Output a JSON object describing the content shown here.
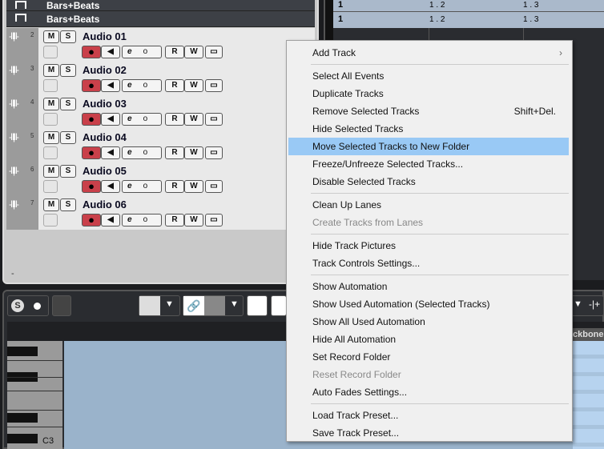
{
  "ruler": {
    "label": "Bars+Beats",
    "marks": [
      "1",
      "1 . 2",
      "1 . 3"
    ]
  },
  "tracks": [
    {
      "num": "2",
      "name": "Audio 01"
    },
    {
      "num": "3",
      "name": "Audio 02"
    },
    {
      "num": "4",
      "name": "Audio 03"
    },
    {
      "num": "5",
      "name": "Audio 04"
    },
    {
      "num": "6",
      "name": "Audio 05"
    },
    {
      "num": "7",
      "name": "Audio 06"
    }
  ],
  "track_buttons": {
    "mute": "M",
    "solo": "S",
    "read": "R",
    "write": "W",
    "edit": "e",
    "monitor_dot": "o"
  },
  "footer_dash": "-",
  "editor": {
    "key_label": "C3",
    "lane_header": "ckbone"
  },
  "menu": [
    {
      "label": "Add Track",
      "submenu": true
    },
    {
      "sep": true
    },
    {
      "label": "Select All Events"
    },
    {
      "label": "Duplicate Tracks"
    },
    {
      "label": "Remove Selected Tracks",
      "shortcut": "Shift+Del."
    },
    {
      "label": "Hide Selected Tracks"
    },
    {
      "label": "Move Selected Tracks to New Folder",
      "highlighted": true
    },
    {
      "label": "Freeze/Unfreeze Selected Tracks..."
    },
    {
      "label": "Disable Selected Tracks"
    },
    {
      "sep": true
    },
    {
      "label": "Clean Up Lanes"
    },
    {
      "label": "Create Tracks from Lanes",
      "disabled": true
    },
    {
      "sep": true
    },
    {
      "label": "Hide Track Pictures"
    },
    {
      "label": "Track Controls Settings..."
    },
    {
      "sep": true
    },
    {
      "label": "Show Automation"
    },
    {
      "label": "Show Used Automation (Selected Tracks)"
    },
    {
      "label": "Show All Used Automation"
    },
    {
      "label": "Hide All Automation"
    },
    {
      "label": "Set Record Folder"
    },
    {
      "label": "Reset Record Folder",
      "disabled": true
    },
    {
      "label": "Auto Fades Settings..."
    },
    {
      "sep": true
    },
    {
      "label": "Load Track Preset..."
    },
    {
      "label": "Save Track Preset..."
    }
  ]
}
